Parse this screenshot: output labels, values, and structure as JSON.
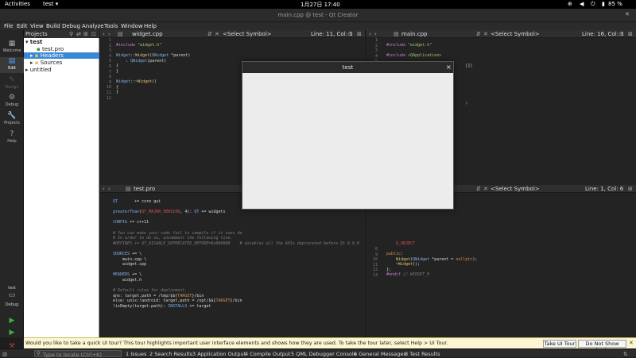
{
  "topbar": {
    "activities": "Activities",
    "app": "test",
    "app_arrow": "▾",
    "clock": "1月27日  17:40",
    "battery": "85 %",
    "icons": [
      "network-icon",
      "volume-icon",
      "battery-icon",
      "power-icon"
    ]
  },
  "window": {
    "title": "main.cpp @ test - Qt Creator",
    "close": "✕"
  },
  "menu": [
    "File",
    "Edit",
    "View",
    "Build",
    "Debug",
    "Analyze",
    "Tools",
    "Window",
    "Help"
  ],
  "modes": [
    {
      "label": "Welcome",
      "icon": "▦"
    },
    {
      "label": "Edit",
      "icon": "▤"
    },
    {
      "label": "Design",
      "icon": "✎"
    },
    {
      "label": "Debug",
      "icon": "⚙"
    },
    {
      "label": "Projects",
      "icon": "🔧"
    },
    {
      "label": "Help",
      "icon": "?"
    }
  ],
  "run_target": {
    "name": "test",
    "mode": "Debug"
  },
  "projects": {
    "title": "Projects",
    "tree": [
      {
        "label": "test",
        "indent": 0,
        "toggle": "▾"
      },
      {
        "label": "test.pro",
        "indent": 2,
        "toggle": ""
      },
      {
        "label": "Headers",
        "indent": 1,
        "toggle": "▸",
        "selected": true
      },
      {
        "label": "Sources",
        "indent": 1,
        "toggle": "▸"
      },
      {
        "label": "untitled",
        "indent": 0,
        "toggle": "▸"
      }
    ]
  },
  "editors": {
    "tl": {
      "file": "widget.cpp",
      "symbol": "<Select Symbol>",
      "pos": "Line: 11, Col: 1"
    },
    "tr": {
      "file": "main.cpp",
      "symbol": "<Select Symbol>",
      "pos": "Line: 16, Col: 1"
    },
    "bl": {
      "file": "test.pro",
      "symbol": "",
      "pos": ""
    },
    "br": {
      "file": "",
      "symbol": "<Select Symbol>",
      "pos": "Line: 1, Col: 6"
    }
  },
  "dialog": {
    "title": "test",
    "close": "×"
  },
  "tour": {
    "message": "Would you like to take a quick UI tour? This tour highlights important user interface elements and shows how they are used. To take the tour later, select Help > UI Tour.",
    "take": "Take UI Tour",
    "dismiss": "Do Not Show Again"
  },
  "status": {
    "locate_placeholder": "Type to locate (Ctrl+K)",
    "tabs": [
      "1 Issues",
      "2 Search Results",
      "3 Application Output",
      "4 Compile Output",
      "5 QML Debugger Console",
      "6 General Messages",
      "8 Test Results"
    ]
  },
  "colors": {
    "accent": "#3a87d6",
    "tour_bg": "#fcf6d2"
  }
}
